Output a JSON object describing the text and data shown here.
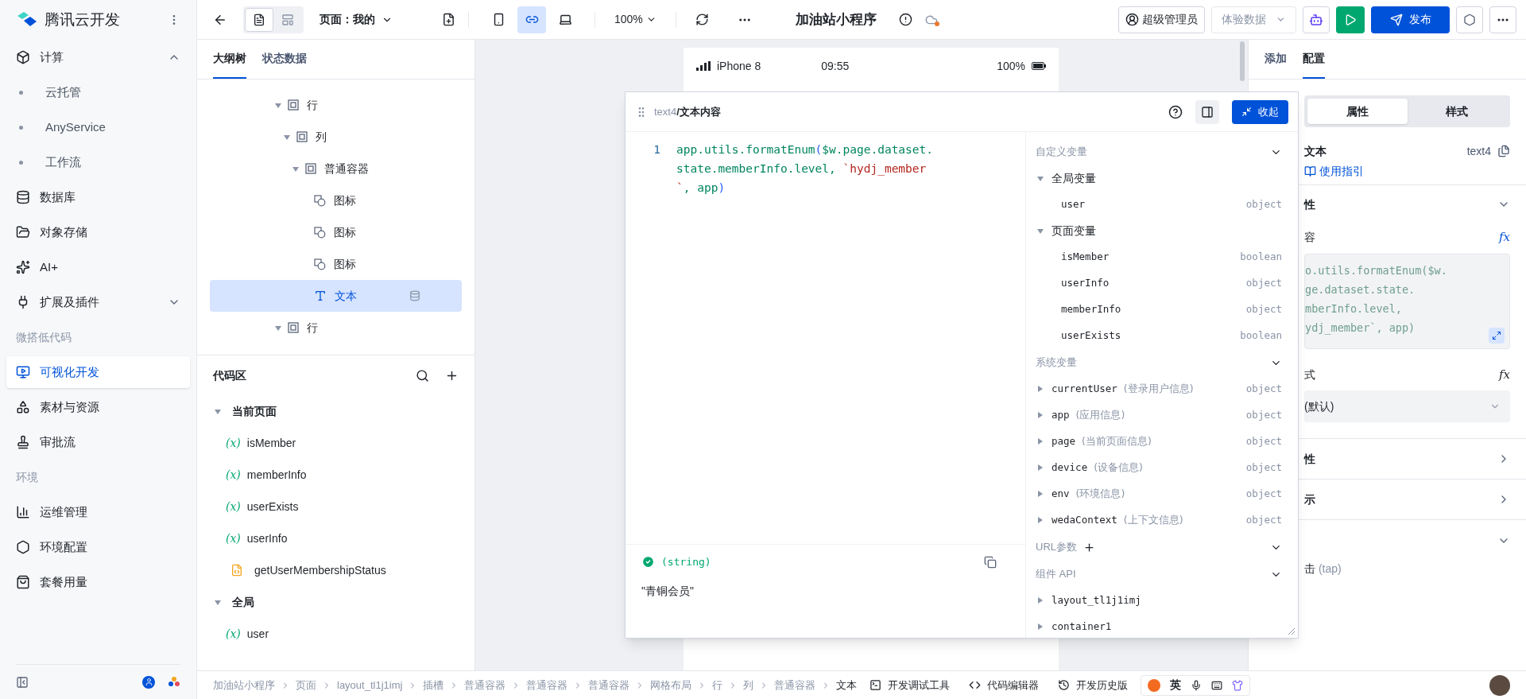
{
  "sidebar": {
    "title": "腾讯云开发",
    "sections": [
      {
        "items": [
          {
            "label": "计算",
            "selected": false,
            "expanded": true,
            "children": [
              {
                "label": "云托管",
                "selected": false
              },
              {
                "label": "AnyService",
                "selected": false
              },
              {
                "label": "工作流",
                "selected": false
              }
            ]
          },
          {
            "label": "数据库",
            "selected": false
          },
          {
            "label": "对象存储",
            "selected": false
          },
          {
            "label": "AI+",
            "selected": false
          },
          {
            "label": "扩展及插件",
            "selected": false,
            "expanded": false
          }
        ]
      },
      {
        "label": "微搭低代码",
        "items": [
          {
            "label": "可视化开发",
            "selected": true
          },
          {
            "label": "素材与资源",
            "selected": false
          },
          {
            "label": "审批流",
            "selected": false
          }
        ]
      },
      {
        "label": "环境",
        "items": [
          {
            "label": "运维管理",
            "selected": false
          },
          {
            "label": "环境配置",
            "selected": false
          },
          {
            "label": "套餐用量",
            "selected": false
          }
        ]
      }
    ]
  },
  "topbar": {
    "view_modes": [
      {
        "selected": true
      },
      {
        "selected": false
      }
    ],
    "page_selector": "页面：我的",
    "devices": [
      {
        "kind": "phone",
        "selected": false
      },
      {
        "kind": "miniprogram",
        "selected": true
      },
      {
        "kind": "desktop",
        "selected": false
      }
    ],
    "zoom": "100%",
    "app_title": "加油站小程序",
    "role": "超级管理员",
    "data_source": "体验数据",
    "publish": "发布"
  },
  "outline": {
    "tabs": [
      {
        "label": "大纲树",
        "selected": true
      },
      {
        "label": "状态数据",
        "selected": false
      }
    ],
    "tree": [
      {
        "label": "行",
        "kind": "container",
        "selected": false,
        "expanded": true,
        "children": [
          {
            "label": "列",
            "kind": "container",
            "selected": false,
            "expanded": true,
            "children": [
              {
                "label": "普通容器",
                "kind": "container",
                "selected": false,
                "expanded": true,
                "children": [
                  {
                    "label": "图标",
                    "kind": "icon",
                    "selected": false
                  },
                  {
                    "label": "图标",
                    "kind": "icon",
                    "selected": false
                  },
                  {
                    "label": "图标",
                    "kind": "icon",
                    "selected": false
                  },
                  {
                    "label": "文本",
                    "kind": "text",
                    "selected": true,
                    "bound": true
                  }
                ]
              }
            ]
          }
        ]
      },
      {
        "label": "行",
        "kind": "container",
        "selected": false,
        "expanded": true
      }
    ]
  },
  "code_area": {
    "title": "代码区",
    "groups": [
      {
        "label": "当前页面",
        "expanded": true,
        "items": [
          {
            "kind": "variable",
            "icon": "(x)",
            "name": "isMember"
          },
          {
            "kind": "variable",
            "icon": "(x)",
            "name": "memberInfo"
          },
          {
            "kind": "variable",
            "icon": "(x)",
            "name": "userExists"
          },
          {
            "kind": "variable",
            "icon": "(x)",
            "name": "userInfo"
          },
          {
            "kind": "function",
            "name": "getUserMembershipStatus"
          }
        ]
      },
      {
        "label": "全局",
        "expanded": true,
        "items": [
          {
            "kind": "variable",
            "icon": "(x)",
            "name": "user"
          }
        ]
      }
    ]
  },
  "preview": {
    "device": "iPhone 8",
    "time": "09:55",
    "battery": "100%"
  },
  "editor": {
    "component": "text4",
    "field": "/文本内容",
    "collapse": "收起",
    "line_number": "1",
    "code": [
      {
        "kind": "plain",
        "text": "app.utils.formatEnum"
      },
      {
        "kind": "bracket",
        "text": "("
      },
      {
        "kind": "plain",
        "text": "$w.page.dataset.state.memberInfo.level"
      },
      {
        "kind": "plain",
        "text": ", "
      },
      {
        "kind": "string",
        "text": "`hydj_member`"
      },
      {
        "kind": "plain",
        "text": ", app"
      },
      {
        "kind": "bracket",
        "text": ")"
      }
    ],
    "result": {
      "type": "(string)",
      "value": "\"青铜会员\""
    },
    "variables": [
      {
        "title": "自定义变量",
        "groups": [
          {
            "label": "全局变量",
            "expanded": true,
            "items": [
              {
                "name": "user",
                "type": "object"
              }
            ]
          },
          {
            "label": "页面变量",
            "expanded": true,
            "items": [
              {
                "name": "isMember",
                "type": "boolean"
              },
              {
                "name": "userInfo",
                "type": "object"
              },
              {
                "name": "memberInfo",
                "type": "object"
              },
              {
                "name": "userExists",
                "type": "boolean"
              }
            ]
          }
        ]
      },
      {
        "title": "系统变量",
        "items": [
          {
            "name": "currentUser",
            "note": "(登录用户信息)",
            "type": "object",
            "expanded": false
          },
          {
            "name": "app",
            "note": "(应用信息)",
            "type": "object",
            "expanded": false
          },
          {
            "name": "page",
            "note": "(当前页面信息)",
            "type": "object",
            "expanded": false
          },
          {
            "name": "device",
            "note": "(设备信息)",
            "type": "object",
            "expanded": false
          },
          {
            "name": "env",
            "note": "(环境信息)",
            "type": "object",
            "expanded": false
          },
          {
            "name": "wedaContext",
            "note": "(上下文信息)",
            "type": "object",
            "expanded": false
          }
        ]
      },
      {
        "title": "URL参数",
        "addable": true
      },
      {
        "title": "组件 API",
        "items": [
          {
            "name": "layout_tl1j1imj",
            "expanded": false
          },
          {
            "name": "container1",
            "expanded": false
          }
        ]
      }
    ]
  },
  "config": {
    "tabs": [
      {
        "label": "添加",
        "selected": false
      },
      {
        "label": "配置",
        "selected": true
      }
    ],
    "segments": [
      {
        "label": "属性",
        "selected": true
      },
      {
        "label": "样式",
        "selected": false
      }
    ],
    "component": {
      "name": "文本",
      "guide": "使用指引",
      "id": "text4"
    },
    "section_1": {
      "title": "性",
      "expanded": true
    },
    "content_label": "容",
    "content_formula": "fx",
    "content_code": [
      "o.utils.formatEnum($w.",
      "ge.dataset.state.",
      "mberInfo.level,",
      "ydj_member`, app)"
    ],
    "format_label": "式",
    "format_formula": "fx",
    "format_value": "(默认)",
    "section_2": {
      "title": "性",
      "expanded": false
    },
    "section_3": {
      "title": "示",
      "expanded": false
    },
    "section_4": {
      "expanded": true
    },
    "event": "击",
    "event_note": "(tap)"
  },
  "breadcrumb": [
    "加油站小程序",
    "页面",
    "layout_tl1j1imj",
    "插槽",
    "普通容器",
    "普通容器",
    "普通容器",
    "网格布局",
    "行",
    "列",
    "普通容器",
    "文本"
  ],
  "tools": [
    "开发调试工具",
    "代码编辑器",
    "开发历史版"
  ],
  "ime": {
    "mode": "英"
  }
}
